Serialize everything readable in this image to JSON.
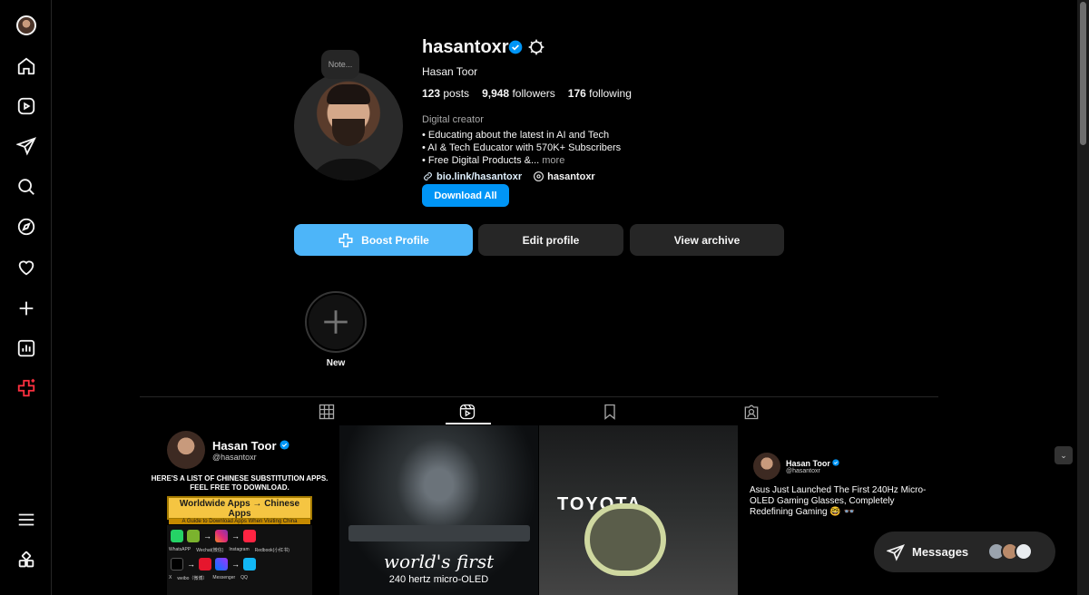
{
  "sidebar": {
    "items": [
      {
        "name": "profile-avatar"
      },
      {
        "name": "home-icon"
      },
      {
        "name": "reels-icon"
      },
      {
        "name": "messages-icon"
      },
      {
        "name": "search-icon"
      },
      {
        "name": "explore-icon"
      },
      {
        "name": "notifications-icon"
      },
      {
        "name": "create-icon"
      },
      {
        "name": "dashboard-icon"
      },
      {
        "name": "meta-ai-icon"
      },
      {
        "name": "more-menu-icon"
      },
      {
        "name": "also-from-meta-icon"
      }
    ]
  },
  "profile": {
    "note": "Note...",
    "username": "hasantoxr",
    "full_name": "Hasan Toor",
    "posts_count": "123",
    "posts_label": "posts",
    "followers_count": "9,948",
    "followers_label": "followers",
    "following_count": "176",
    "following_label": "following",
    "category": "Digital creator",
    "bio": [
      "• Educating about the latest in AI and Tech",
      "• AI & Tech Educator with 570K+ Subscribers",
      "• Free Digital Products &..."
    ],
    "bio_more": "more",
    "link": "bio.link/hasantoxr",
    "threads_handle": "hasantoxr",
    "download_label": "Download All"
  },
  "actions": {
    "boost": "Boost Profile",
    "edit": "Edit profile",
    "archive": "View archive"
  },
  "highlights": {
    "new_label": "New"
  },
  "tabs": [
    "posts-grid",
    "reels",
    "saved",
    "tagged"
  ],
  "grid": {
    "post1": {
      "name": "Hasan Toor",
      "handle": "@hasantoxr",
      "headline": "HERE'S A LIST OF CHINESE SUBSTITUTION APPS. FEEL FREE TO DOWNLOAD.",
      "banner_title": "Worldwide Apps → Chinese Apps",
      "banner_sub": "A Guide to Download Apps When Visiting China",
      "labels_row1": [
        "WhatsAPP",
        "Wechat(微信)",
        "Instagram",
        "Redbook(小红书)"
      ],
      "labels_row2": [
        "X",
        "weibo（微博）",
        "Messenger",
        "QQ"
      ]
    },
    "post2": {
      "title": "world's first",
      "subtitle": "240 hertz micro-OLED"
    },
    "post3": {
      "brand": "TOYOTA"
    },
    "post4": {
      "name": "Hasan Toor",
      "handle": "@hasantoxr",
      "text": "Asus Just Launched The First 240Hz Micro-OLED Gaming Glasses, Completely Redefining Gaming 🤓 👓"
    }
  },
  "messages": {
    "label": "Messages"
  },
  "colors": {
    "primary_blue": "#0095f6",
    "boost_blue": "#4db5f9",
    "button_gray": "#262626",
    "accent_pink": "#ff3040"
  }
}
